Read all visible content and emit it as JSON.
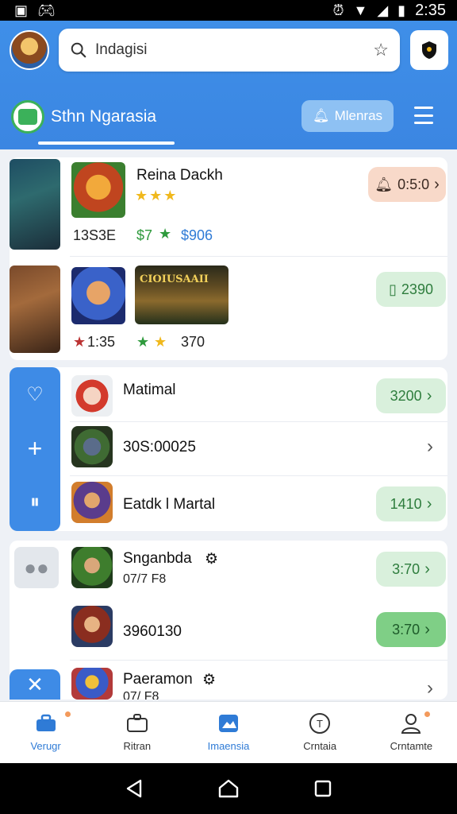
{
  "status_bar": {
    "time": "2:35"
  },
  "header": {
    "search_value": "Indagisi",
    "tab_title": "Sthn Ngarasia",
    "pill_label": "Mlenras"
  },
  "card1": {
    "row1": {
      "title": "Reina Dackh",
      "rating_stars": 3,
      "count": "13S3E",
      "price_green": "$7",
      "price_blue": "$906",
      "badge": "0:5:0"
    },
    "row2": {
      "wide_thumb_label": "CIOIUSAAII",
      "meta_left": "1:35",
      "meta_right": "370",
      "badge": "2390"
    }
  },
  "card2": {
    "rows": [
      {
        "title": "Matimal",
        "badge": "3200"
      },
      {
        "title": "30S:00025"
      },
      {
        "title": "Eatdk l Martal",
        "badge": "1410"
      }
    ]
  },
  "card3": {
    "rows": [
      {
        "title": "Snganbda",
        "subtitle": "07/7 F8",
        "badge": "3:70"
      },
      {
        "title": "3960130",
        "badge": "3:70"
      },
      {
        "title": "Paeramon",
        "subtitle": "07/ F8"
      }
    ]
  },
  "bottom_nav": {
    "items": [
      {
        "label": "Verugr",
        "icon": "toolbox-icon"
      },
      {
        "label": "Ritran",
        "icon": "briefcase-icon"
      },
      {
        "label": "Imaensia",
        "icon": "image-icon"
      },
      {
        "label": "Crntaia",
        "icon": "compass-icon"
      },
      {
        "label": "Crntamte",
        "icon": "user-icon"
      }
    ]
  },
  "colors": {
    "accent": "#3e8be6",
    "green": "#2e9a3c",
    "orange_badge": "#f8d9c9"
  }
}
